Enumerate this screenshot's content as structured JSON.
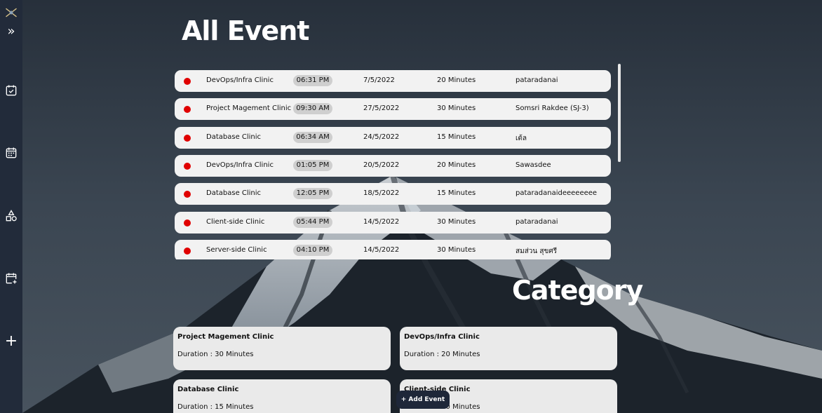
{
  "sidebar": {
    "items": [
      {
        "icon": "logo-icon"
      },
      {
        "icon": "expand-icon",
        "label": "»"
      },
      {
        "icon": "calendar-check-icon"
      },
      {
        "icon": "calendar-grid-icon"
      },
      {
        "icon": "shapes-icon"
      },
      {
        "icon": "calendar-add-icon"
      },
      {
        "icon": "plus-icon",
        "label": "+"
      }
    ]
  },
  "events_title": "All Event",
  "events": [
    {
      "name": "DevOps/Infra Clinic",
      "time": "06:31 PM",
      "date": "7/5/2022",
      "duration": "20 Minutes",
      "host": "pataradanai"
    },
    {
      "name": "Project Magement Clinic",
      "time": "09:30 AM",
      "date": "27/5/2022",
      "duration": "30 Minutes",
      "host": "Somsri Rakdee (SJ-3)"
    },
    {
      "name": "Database Clinic",
      "time": "06:34 AM",
      "date": "24/5/2022",
      "duration": "15 Minutes",
      "host": "เต้ล"
    },
    {
      "name": "DevOps/Infra Clinic",
      "time": "01:05 PM",
      "date": "20/5/2022",
      "duration": "20 Minutes",
      "host": "Sawasdee"
    },
    {
      "name": "Database Clinic",
      "time": "12:05 PM",
      "date": "18/5/2022",
      "duration": "15 Minutes",
      "host": "pataradanaideeeeeeee"
    },
    {
      "name": "Client-side Clinic",
      "time": "05:44 PM",
      "date": "14/5/2022",
      "duration": "30 Minutes",
      "host": "pataradanai"
    },
    {
      "name": "Server-side Clinic",
      "time": "04:10 PM",
      "date": "14/5/2022",
      "duration": "30 Minutes",
      "host": "สมส่วน สุขศรี"
    }
  ],
  "category_title": "Category",
  "categories": [
    {
      "name": "Project Magement Clinic",
      "duration": "Duration : 30 Minutes"
    },
    {
      "name": "DevOps/Infra Clinic",
      "duration": "Duration : 20 Minutes"
    },
    {
      "name": "Database Clinic",
      "duration": "Duration : 15 Minutes"
    },
    {
      "name": "Client-side Clinic",
      "duration": "Duration : 30 Minutes"
    }
  ],
  "add_event_label": "+ Add Event",
  "colors": {
    "sidebar": "#222b3a",
    "status_dot": "#e00000",
    "row_bg": "#f2f2f2",
    "card_bg": "#eaeaea",
    "button_bg": "#1e2739"
  }
}
